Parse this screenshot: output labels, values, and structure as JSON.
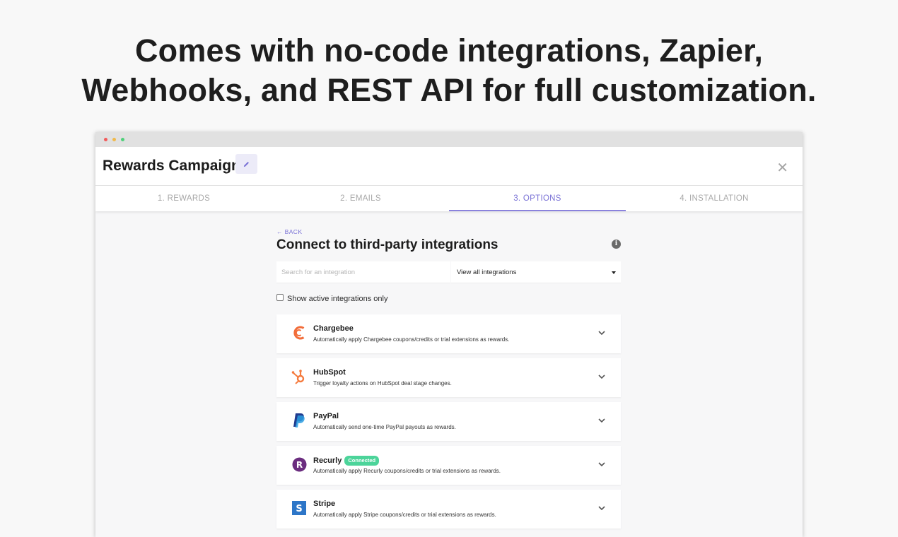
{
  "headline": {
    "line1": "Comes with no-code integrations, Zapier,",
    "line2": "Webhooks, and REST API for full customization."
  },
  "app": {
    "title": "Rewards Campaign",
    "close_glyph": "✕"
  },
  "tabs": [
    {
      "label": "1. REWARDS",
      "active": false
    },
    {
      "label": "2. EMAILS",
      "active": false
    },
    {
      "label": "3. OPTIONS",
      "active": true
    },
    {
      "label": "4. INSTALLATION",
      "active": false
    }
  ],
  "content": {
    "back_label": "← BACK",
    "title": "Connect to third-party integrations",
    "info_glyph": "i",
    "search_placeholder": "Search for an integration",
    "filter_selected": "View all integrations",
    "checkbox_label": "Show active integrations only",
    "checkbox_checked": false
  },
  "integrations": [
    {
      "name": "Chargebee",
      "description": "Automatically apply Chargebee coupons/credits or trial extensions as rewards.",
      "icon": "chargebee-icon",
      "color": "#f26d3a",
      "badge": ""
    },
    {
      "name": "HubSpot",
      "description": "Trigger loyalty actions on HubSpot deal stage changes.",
      "icon": "hubspot-icon",
      "color": "#f57a3d",
      "badge": ""
    },
    {
      "name": "PayPal",
      "description": "Automatically send one-time PayPal payouts as rewards.",
      "icon": "paypal-icon",
      "color": "#213c8f",
      "badge": ""
    },
    {
      "name": "Recurly",
      "description": "Automatically apply Recurly coupons/credits or trial extensions as rewards.",
      "icon": "recurly-icon",
      "color": "#6b2d7f",
      "badge": "Connected"
    },
    {
      "name": "Stripe",
      "description": "Automatically apply Stripe coupons/credits or trial extensions as rewards.",
      "icon": "stripe-icon",
      "color": "#2d76c8",
      "badge": ""
    }
  ],
  "colors": {
    "accent": "#7a72d6",
    "badge_green": "#4cd49a"
  }
}
